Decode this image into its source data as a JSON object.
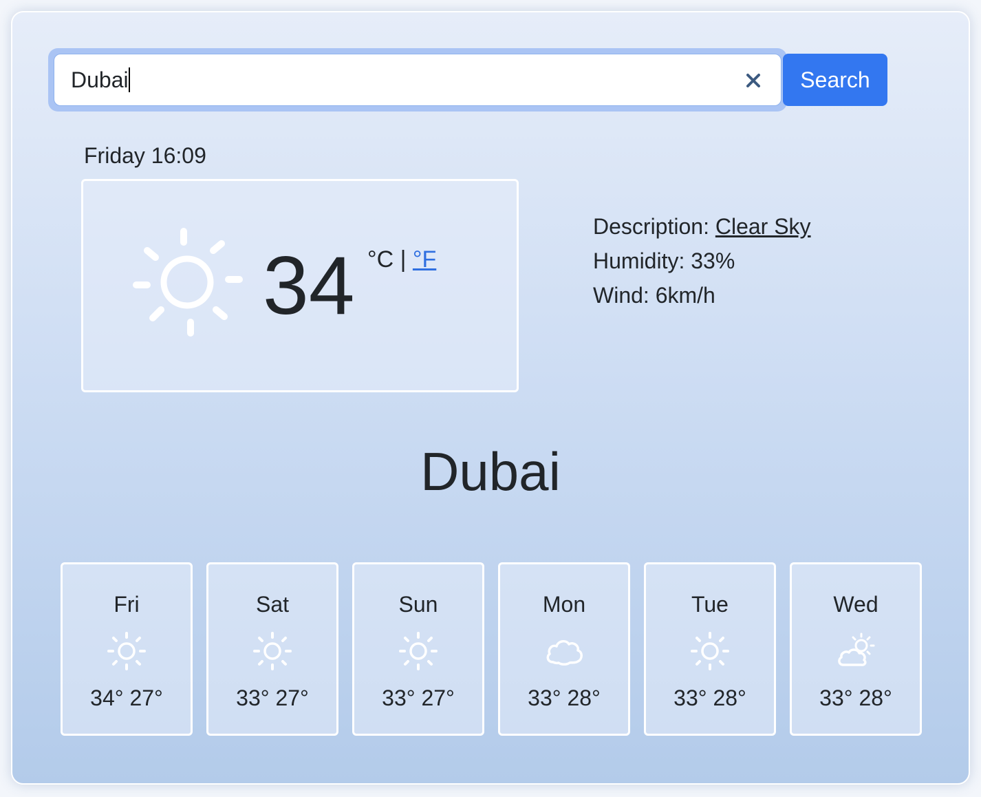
{
  "search": {
    "value": "Dubai",
    "button_label": "Search"
  },
  "current": {
    "datetime": "Friday 16:09",
    "temperature": "34",
    "unit_celsius": "°C",
    "unit_separator": " | ",
    "unit_fahrenheit": "°F",
    "icon": "sun-icon",
    "description_label": "Description:",
    "description_value": "Clear Sky",
    "humidity": "Humidity: 33%",
    "wind": "Wind: 6km/h"
  },
  "city": "Dubai",
  "forecast": [
    {
      "day": "Fri",
      "icon": "sun-icon",
      "temps": "34° 27°"
    },
    {
      "day": "Sat",
      "icon": "sun-icon",
      "temps": "33° 27°"
    },
    {
      "day": "Sun",
      "icon": "sun-icon",
      "temps": "33° 27°"
    },
    {
      "day": "Mon",
      "icon": "cloud-icon",
      "temps": "33° 28°"
    },
    {
      "day": "Tue",
      "icon": "sun-icon",
      "temps": "33° 28°"
    },
    {
      "day": "Wed",
      "icon": "partly-cloudy-icon",
      "temps": "33° 28°"
    }
  ],
  "colors": {
    "accent": "#3377f0",
    "link": "#2f6fe0",
    "icon": "#ffffff"
  }
}
